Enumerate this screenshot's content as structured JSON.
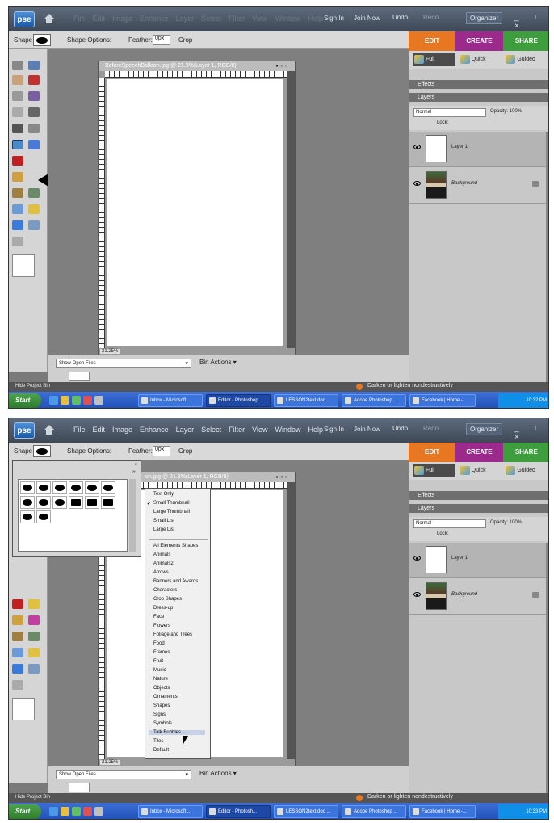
{
  "top": {
    "titlebar": {
      "logo": "pse",
      "menus": [
        "File",
        "Edit",
        "Image",
        "Enhance",
        "Layer",
        "Select",
        "Filter",
        "View",
        "Window",
        "Help"
      ],
      "sign_in": "Sign In",
      "join_now": "Join Now",
      "undo": "Undo",
      "redo": "Redo",
      "organizer": "Organizer",
      "window_controls": "_ □ ×"
    },
    "options": {
      "shape_label": "Shape",
      "shape_options": "Shape Options:",
      "feather_label": "Feather:",
      "feather_value": "0px",
      "crop_label": "Crop"
    },
    "modes": {
      "edit": "EDIT",
      "create": "CREATE",
      "share": "SHARE"
    },
    "subtabs": {
      "full": "Full",
      "quick": "Quick",
      "guided": "Guided"
    },
    "palettes": {
      "effects": "Effects",
      "layers": "Layers"
    },
    "layer_toolbar": {
      "blend": "Normal",
      "opacity": "Opacity: 100%",
      "lock": "Lock:"
    },
    "layers": [
      {
        "name": "Layer 1"
      },
      {
        "name": "Background"
      }
    ],
    "doc": {
      "title": "BeforeSpeechBalloon.jpg @ 21.3%(Layer 1, RGB/8)",
      "zoom": "21.25%"
    },
    "bin": {
      "show_open": "Show Open Files",
      "bin_actions": "Bin Actions ▾"
    },
    "status": {
      "hide_bin": "Hide Project Bin",
      "message": "Darken or lighten nondestructively"
    },
    "taskbar": {
      "start": "Start",
      "buttons": [
        "Inbox - Microsoft ...",
        "Editor - Photoshop...",
        "LESSON2text.doc ...",
        "Adobe Photoshop ...",
        "Facebook | Home -..."
      ],
      "time": "10:32 PM"
    }
  },
  "bottom": {
    "titlebar": {
      "logo": "pse",
      "menus": [
        "File",
        "Edit",
        "Image",
        "Enhance",
        "Layer",
        "Select",
        "Filter",
        "View",
        "Window",
        "Help"
      ],
      "sign_in": "Sign In",
      "join_now": "Join Now",
      "undo": "Undo",
      "redo": "Redo",
      "organizer": "Organizer",
      "window_controls": "_ □ ×"
    },
    "options": {
      "shape_label": "Shape",
      "shape_options": "Shape Options:",
      "feather_label": "Feather:",
      "feather_value": "0px",
      "crop_label": "Crop"
    },
    "modes": {
      "edit": "EDIT",
      "create": "CREATE",
      "share": "SHARE"
    },
    "subtabs": {
      "full": "Full",
      "quick": "Quick",
      "guided": "Guided"
    },
    "palettes": {
      "effects": "Effects",
      "layers": "Layers"
    },
    "layer_toolbar": {
      "blend": "Normal",
      "opacity": "Opacity: 100%",
      "lock": "Lock:"
    },
    "layers": [
      {
        "name": "Layer 1"
      },
      {
        "name": "Background"
      }
    ],
    "doc": {
      "title": "on.jpg @ 21.3%(Layer 1, RGB/8)",
      "zoom": "21.25%"
    },
    "bin": {
      "show_open": "Show Open Files",
      "bin_actions": "Bin Actions ▾"
    },
    "status": {
      "hide_bin": "Hide Project Bin",
      "message": "Darken or lighten nondestructively"
    },
    "taskbar": {
      "start": "Start",
      "buttons": [
        "Inbox - Microsoft ...",
        "Editor - Photosh...",
        "LESSON2text.doc ...",
        "Adobe Photoshop ...",
        "Facebook | Home -..."
      ],
      "time": "10:33 PM"
    },
    "picker": {
      "more": "»",
      "close": "×"
    },
    "menu": {
      "view_items": [
        "Text Only",
        "Small Thumbnail",
        "Large Thumbnail",
        "Small List",
        "Large List"
      ],
      "checked": "Small Thumbnail",
      "libraries": [
        "All Elements Shapes",
        "Animals",
        "Animals2",
        "Arrows",
        "Banners and Awards",
        "Characters",
        "Crop Shapes",
        "Dress-up",
        "Face",
        "Flowers",
        "Foliage and Trees",
        "Food",
        "Frames",
        "Fruit",
        "Music",
        "Nature",
        "Objects",
        "Ornaments",
        "Shapes",
        "Signs",
        "Symbols",
        "Talk Bubbles",
        "Tiles",
        "Default"
      ],
      "highlighted": "Talk Bubbles"
    }
  }
}
